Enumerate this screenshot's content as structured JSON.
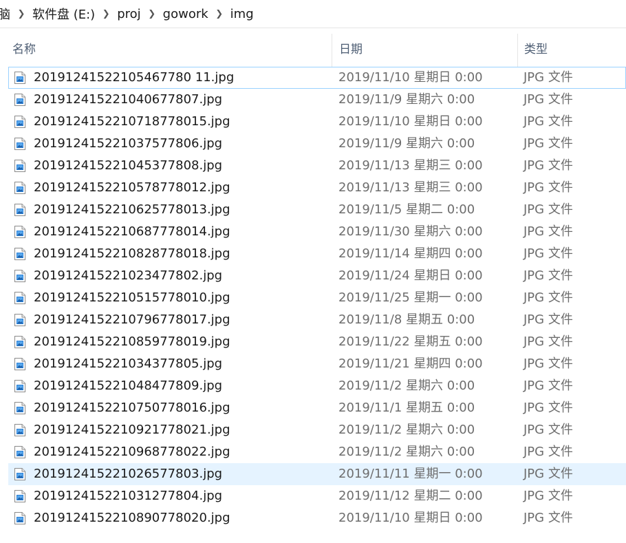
{
  "breadcrumb": {
    "items": [
      "脑",
      "软件盘 (E:)",
      "proj",
      "gowork",
      "img"
    ],
    "separator": "❯"
  },
  "columns": {
    "name": "名称",
    "date": "日期",
    "type": "类型"
  },
  "files": [
    {
      "name": "20191241522105467780 11.jpg",
      "date": "2019/11/10 星期日 0:00",
      "type": "JPG 文件"
    },
    {
      "name": "201912415221040677807.jpg",
      "date": "2019/11/9 星期六 0:00",
      "type": "JPG 文件"
    },
    {
      "name": "2019124152210718778015.jpg",
      "date": "2019/11/10 星期日 0:00",
      "type": "JPG 文件"
    },
    {
      "name": "201912415221037577806.jpg",
      "date": "2019/11/9 星期六 0:00",
      "type": "JPG 文件"
    },
    {
      "name": "201912415221045377808.jpg",
      "date": "2019/11/13 星期三 0:00",
      "type": "JPG 文件"
    },
    {
      "name": "2019124152210578778012.jpg",
      "date": "2019/11/13 星期三 0:00",
      "type": "JPG 文件"
    },
    {
      "name": "2019124152210625778013.jpg",
      "date": "2019/11/5 星期二 0:00",
      "type": "JPG 文件"
    },
    {
      "name": "2019124152210687778014.jpg",
      "date": "2019/11/30 星期六 0:00",
      "type": "JPG 文件"
    },
    {
      "name": "2019124152210828778018.jpg",
      "date": "2019/11/14 星期四 0:00",
      "type": "JPG 文件"
    },
    {
      "name": "201912415221023477802.jpg",
      "date": "2019/11/24 星期日 0:00",
      "type": "JPG 文件"
    },
    {
      "name": "2019124152210515778010.jpg",
      "date": "2019/11/25 星期一 0:00",
      "type": "JPG 文件"
    },
    {
      "name": "2019124152210796778017.jpg",
      "date": "2019/11/8 星期五 0:00",
      "type": "JPG 文件"
    },
    {
      "name": "2019124152210859778019.jpg",
      "date": "2019/11/22 星期五 0:00",
      "type": "JPG 文件"
    },
    {
      "name": "201912415221034377805.jpg",
      "date": "2019/11/21 星期四 0:00",
      "type": "JPG 文件"
    },
    {
      "name": "201912415221048477809.jpg",
      "date": "2019/11/2 星期六 0:00",
      "type": "JPG 文件"
    },
    {
      "name": "2019124152210750778016.jpg",
      "date": "2019/11/1 星期五 0:00",
      "type": "JPG 文件"
    },
    {
      "name": "2019124152210921778021.jpg",
      "date": "2019/11/2 星期六 0:00",
      "type": "JPG 文件"
    },
    {
      "name": "2019124152210968778022.jpg",
      "date": "2019/11/2 星期六 0:00",
      "type": "JPG 文件"
    },
    {
      "name": "201912415221026577803.jpg",
      "date": "2019/11/11 星期一 0:00",
      "type": "JPG 文件"
    },
    {
      "name": "201912415221031277804.jpg",
      "date": "2019/11/12 星期二 0:00",
      "type": "JPG 文件"
    },
    {
      "name": "2019124152210890778020.jpg",
      "date": "2019/11/10 星期日 0:00",
      "type": "JPG 文件"
    }
  ],
  "state": {
    "focused_row": 0,
    "hovered_row": 18
  },
  "colors": {
    "hover_bg": "#e5f3ff",
    "focus_border": "#99d1ff",
    "header_text": "#4d5d73",
    "secondary_text": "#6d6d6d"
  },
  "icons": {
    "file": "jpg-file-icon",
    "separator": "chevron-right-icon"
  }
}
